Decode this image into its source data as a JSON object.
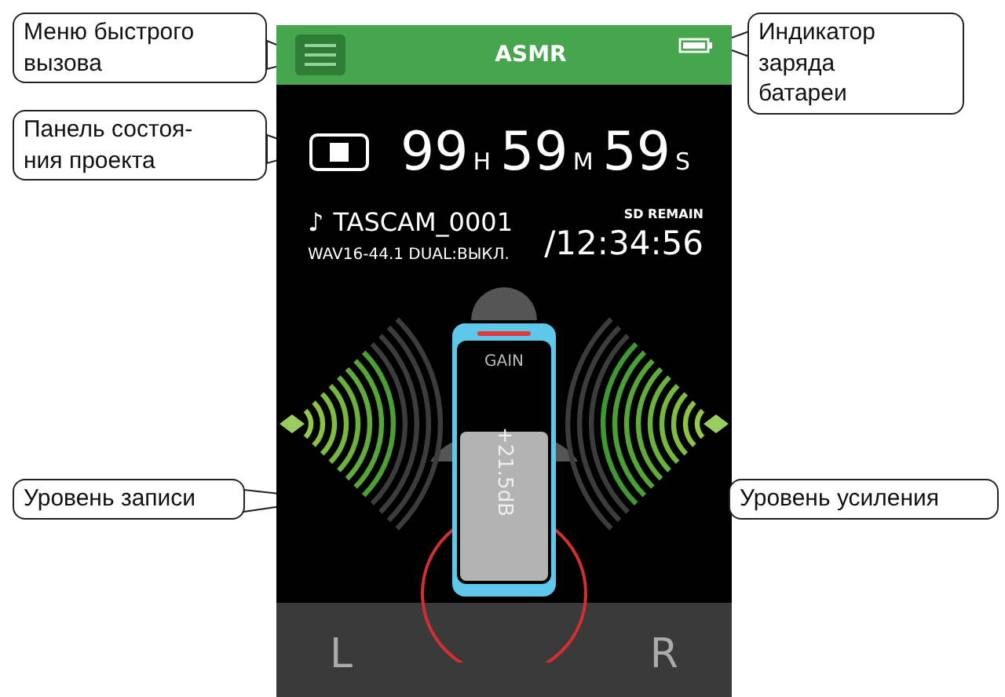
{
  "screen": {
    "title": "ASMR",
    "time": [
      {
        "value": "99",
        "unit": "H"
      },
      {
        "value": "59",
        "unit": "M"
      },
      {
        "value": "59",
        "unit": "S"
      }
    ],
    "file": {
      "note": "♪",
      "name": "TASCAM_0001",
      "format": "WAV16-44.1 DUAL:ВЫКЛ."
    },
    "remain": {
      "label": "SD REMAIN",
      "value": "/12:34:56"
    },
    "meters": [
      {
        "label": "L",
        "level": 0.7
      },
      {
        "label": "R",
        "level": 0.75
      }
    ],
    "gain": {
      "label": "GAIN",
      "reading": "+21.5dB",
      "level": 0.62
    }
  },
  "callouts": [
    {
      "lines": [
        "Меню быстрого",
        "вызова"
      ]
    },
    {
      "lines": [
        "Индикатор",
        "заряда",
        "батареи"
      ]
    },
    {
      "lines": [
        "Панель состоя-",
        "ния проекта"
      ]
    },
    {
      "lines": [
        "Уровень записи"
      ]
    },
    {
      "lines": [
        "Уровень усиления"
      ]
    }
  ]
}
